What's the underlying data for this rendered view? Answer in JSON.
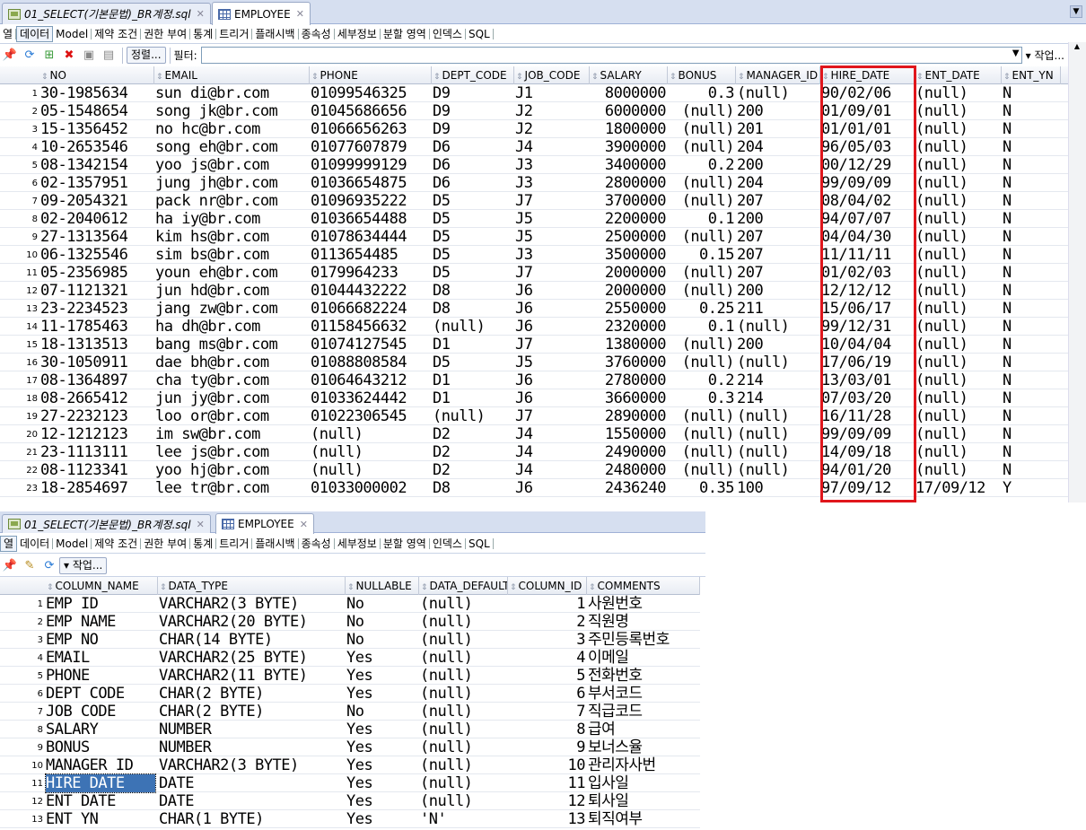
{
  "top_panel": {
    "tabs": [
      {
        "label": "01_SELECT(기본문법)_BR계정.sql",
        "active": false
      },
      {
        "label": "EMPLOYEE",
        "active": true
      }
    ],
    "subtabs": [
      "열",
      "데이터",
      "Model",
      "제약 조건",
      "권한 부여",
      "통계",
      "트리거",
      "플래시백",
      "종속성",
      "세부정보",
      "분할 영역",
      "인덱스",
      "SQL"
    ],
    "active_subtab": "데이터",
    "toolbar": {
      "sort_label": "정렬...",
      "filter_label": "필터:",
      "filter_value": "",
      "actions_label": "▾ 작업..."
    },
    "columns": [
      "NO",
      "EMAIL",
      "PHONE",
      "DEPT_CODE",
      "JOB_CODE",
      "SALARY",
      "BONUS",
      "MANAGER_ID",
      "HIRE_DATE",
      "ENT_DATE",
      "ENT_YN"
    ],
    "rows": [
      [
        "30-1985634",
        "sun di@br.com",
        "01099546325",
        "D9",
        "J1",
        "8000000",
        "0.3",
        "(null)",
        "90/02/06",
        "(null)",
        "N"
      ],
      [
        "05-1548654",
        "song jk@br.com",
        "01045686656",
        "D9",
        "J2",
        "6000000",
        "(null)",
        "200",
        "01/09/01",
        "(null)",
        "N"
      ],
      [
        "15-1356452",
        "no hc@br.com",
        "01066656263",
        "D9",
        "J2",
        "1800000",
        "(null)",
        "201",
        "01/01/01",
        "(null)",
        "N"
      ],
      [
        "10-2653546",
        "song eh@br.com",
        "01077607879",
        "D6",
        "J4",
        "3900000",
        "(null)",
        "204",
        "96/05/03",
        "(null)",
        "N"
      ],
      [
        "08-1342154",
        "yoo js@br.com",
        "01099999129",
        "D6",
        "J3",
        "3400000",
        "0.2",
        "200",
        "00/12/29",
        "(null)",
        "N"
      ],
      [
        "02-1357951",
        "jung jh@br.com",
        "01036654875",
        "D6",
        "J3",
        "2800000",
        "(null)",
        "204",
        "99/09/09",
        "(null)",
        "N"
      ],
      [
        "09-2054321",
        "pack nr@br.com",
        "01096935222",
        "D5",
        "J7",
        "3700000",
        "(null)",
        "207",
        "08/04/02",
        "(null)",
        "N"
      ],
      [
        "02-2040612",
        "ha iy@br.com",
        "01036654488",
        "D5",
        "J5",
        "2200000",
        "0.1",
        "200",
        "94/07/07",
        "(null)",
        "N"
      ],
      [
        "27-1313564",
        "kim hs@br.com",
        "01078634444",
        "D5",
        "J5",
        "2500000",
        "(null)",
        "207",
        "04/04/30",
        "(null)",
        "N"
      ],
      [
        "06-1325546",
        "sim bs@br.com",
        "0113654485",
        "D5",
        "J3",
        "3500000",
        "0.15",
        "207",
        "11/11/11",
        "(null)",
        "N"
      ],
      [
        "05-2356985",
        "youn eh@br.com",
        "0179964233",
        "D5",
        "J7",
        "2000000",
        "(null)",
        "207",
        "01/02/03",
        "(null)",
        "N"
      ],
      [
        "07-1121321",
        "jun hd@br.com",
        "01044432222",
        "D8",
        "J6",
        "2000000",
        "(null)",
        "200",
        "12/12/12",
        "(null)",
        "N"
      ],
      [
        "23-2234523",
        "jang zw@br.com",
        "01066682224",
        "D8",
        "J6",
        "2550000",
        "0.25",
        "211",
        "15/06/17",
        "(null)",
        "N"
      ],
      [
        "11-1785463",
        "ha dh@br.com",
        "01158456632",
        "(null)",
        "J6",
        "2320000",
        "0.1",
        "(null)",
        "99/12/31",
        "(null)",
        "N"
      ],
      [
        "18-1313513",
        "bang ms@br.com",
        "01074127545",
        "D1",
        "J7",
        "1380000",
        "(null)",
        "200",
        "10/04/04",
        "(null)",
        "N"
      ],
      [
        "30-1050911",
        "dae bh@br.com",
        "01088808584",
        "D5",
        "J5",
        "3760000",
        "(null)",
        "(null)",
        "17/06/19",
        "(null)",
        "N"
      ],
      [
        "08-1364897",
        "cha ty@br.com",
        "01064643212",
        "D1",
        "J6",
        "2780000",
        "0.2",
        "214",
        "13/03/01",
        "(null)",
        "N"
      ],
      [
        "08-2665412",
        "jun jy@br.com",
        "01033624442",
        "D1",
        "J6",
        "3660000",
        "0.3",
        "214",
        "07/03/20",
        "(null)",
        "N"
      ],
      [
        "27-2232123",
        "loo or@br.com",
        "01022306545",
        "(null)",
        "J7",
        "2890000",
        "(null)",
        "(null)",
        "16/11/28",
        "(null)",
        "N"
      ],
      [
        "12-1212123",
        "im sw@br.com",
        "(null)",
        "D2",
        "J4",
        "1550000",
        "(null)",
        "(null)",
        "99/09/09",
        "(null)",
        "N"
      ],
      [
        "23-1113111",
        "lee js@br.com",
        "(null)",
        "D2",
        "J4",
        "2490000",
        "(null)",
        "(null)",
        "14/09/18",
        "(null)",
        "N"
      ],
      [
        "08-1123341",
        "yoo hj@br.com",
        "(null)",
        "D2",
        "J4",
        "2480000",
        "(null)",
        "(null)",
        "94/01/20",
        "(null)",
        "N"
      ],
      [
        "18-2854697",
        "lee tr@br.com",
        "01033000002",
        "D8",
        "J6",
        "2436240",
        "0.35",
        "100",
        "97/09/12",
        "17/09/12",
        "Y"
      ]
    ]
  },
  "bottom_panel": {
    "tabs": [
      {
        "label": "01_SELECT(기본문법)_BR계정.sql",
        "active": false
      },
      {
        "label": "EMPLOYEE",
        "active": true
      }
    ],
    "subtabs": [
      "열",
      "데이터",
      "Model",
      "제약 조건",
      "권한 부여",
      "통계",
      "트리거",
      "플래시백",
      "종속성",
      "세부정보",
      "분할 영역",
      "인덱스",
      "SQL"
    ],
    "active_subtab": "열",
    "toolbar": {
      "actions_label": "▾ 작업..."
    },
    "columns": [
      "COLUMN_NAME",
      "DATA_TYPE",
      "NULLABLE",
      "DATA_DEFAULT",
      "COLUMN_ID",
      "COMMENTS"
    ],
    "rows": [
      [
        "EMP ID",
        "VARCHAR2(3 BYTE)",
        "No",
        "(null)",
        "1",
        "사원번호"
      ],
      [
        "EMP NAME",
        "VARCHAR2(20 BYTE)",
        "No",
        "(null)",
        "2",
        "직원명"
      ],
      [
        "EMP NO",
        "CHAR(14 BYTE)",
        "No",
        "(null)",
        "3",
        "주민등록번호"
      ],
      [
        "EMAIL",
        "VARCHAR2(25 BYTE)",
        "Yes",
        "(null)",
        "4",
        "이메일"
      ],
      [
        "PHONE",
        "VARCHAR2(11 BYTE)",
        "Yes",
        "(null)",
        "5",
        "전화번호"
      ],
      [
        "DEPT CODE",
        "CHAR(2 BYTE)",
        "Yes",
        "(null)",
        "6",
        "부서코드"
      ],
      [
        "JOB CODE",
        "CHAR(2 BYTE)",
        "No",
        "(null)",
        "7",
        "직급코드"
      ],
      [
        "SALARY",
        "NUMBER",
        "Yes",
        "(null)",
        "8",
        "급여"
      ],
      [
        "BONUS",
        "NUMBER",
        "Yes",
        "(null)",
        "9",
        "보너스율"
      ],
      [
        "MANAGER ID",
        "VARCHAR2(3 BYTE)",
        "Yes",
        "(null)",
        "10",
        "관리자사번"
      ],
      [
        "HIRE DATE",
        "DATE",
        "Yes",
        "(null)",
        "11",
        "입사일"
      ],
      [
        "ENT DATE",
        "DATE",
        "Yes",
        "(null)",
        "12",
        "퇴사일"
      ],
      [
        "ENT YN",
        "CHAR(1 BYTE)",
        "Yes",
        "'N'",
        "13",
        "퇴직여부"
      ]
    ],
    "selected_cell": "HIRE DATE"
  },
  "colors": {
    "highlight_box": "#e0161c",
    "selection": "#3d73b5",
    "tab_bar": "#d6dff0"
  },
  "icons": [
    "pin-icon",
    "refresh-icon",
    "insert-row-icon",
    "delete-row-icon",
    "commit-icon",
    "rollback-icon",
    "edit-icon",
    "sql-file-icon",
    "table-icon"
  ]
}
